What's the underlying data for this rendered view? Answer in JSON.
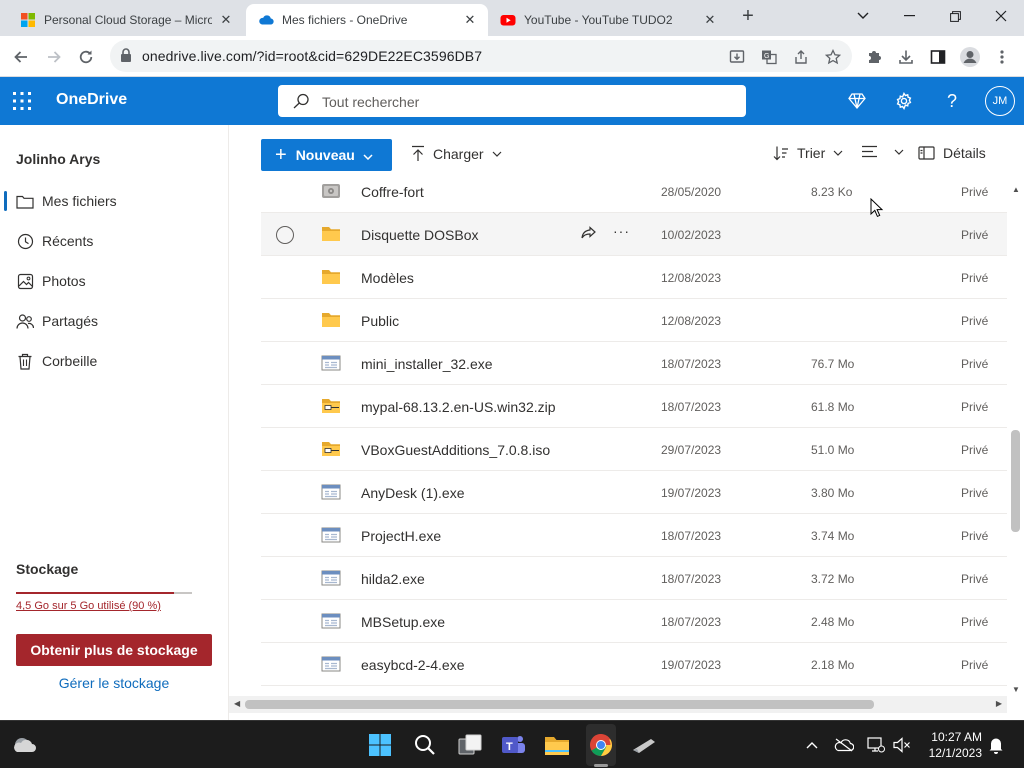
{
  "browser": {
    "tabs": [
      {
        "title": "Personal Cloud Storage – Micros",
        "active": false,
        "favicon": "microsoft-logo-icon"
      },
      {
        "title": "Mes fichiers - OneDrive",
        "active": true,
        "favicon": "onedrive-cloud-icon"
      },
      {
        "title": "YouTube - YouTube TUDO2",
        "active": false,
        "favicon": "youtube-icon"
      }
    ],
    "new_tab": "+",
    "url": "onedrive.live.com/?id=root&cid=629DE22EC3596DB7"
  },
  "header": {
    "app_name": "OneDrive",
    "search_placeholder": "Tout rechercher",
    "avatar_initials": "JM",
    "accent": "#0f78d4"
  },
  "sidebar": {
    "user_name": "Jolinho Arys",
    "items": [
      {
        "label": "Mes fichiers",
        "icon": "folder-icon",
        "selected": true
      },
      {
        "label": "Récents",
        "icon": "clock-icon",
        "selected": false
      },
      {
        "label": "Photos",
        "icon": "photo-icon",
        "selected": false
      },
      {
        "label": "Partagés",
        "icon": "people-icon",
        "selected": false
      },
      {
        "label": "Corbeille",
        "icon": "trash-icon",
        "selected": false
      }
    ],
    "storage": {
      "title": "Stockage",
      "usage_text": "4,5 Go sur 5 Go utilisé (90 %)",
      "usage_fraction": 0.9,
      "get_more_label": "Obtenir plus de stockage",
      "manage_label": "Gérer le stockage",
      "warning_color": "#a4262c"
    }
  },
  "commandbar": {
    "new_label": "Nouveau",
    "upload_label": "Charger",
    "sort_label": "Trier",
    "details_label": "Détails"
  },
  "files": [
    {
      "name": "Coffre-fort",
      "icon": "vault-icon",
      "modified": "28/05/2020",
      "size": "8.23 Ko",
      "access": "Privé"
    },
    {
      "name": "Disquette DOSBox",
      "icon": "folder-icon",
      "modified": "10/02/2023",
      "size": "",
      "access": "Privé"
    },
    {
      "name": "Modèles",
      "icon": "folder-icon",
      "modified": "12/08/2023",
      "size": "",
      "access": "Privé"
    },
    {
      "name": "Public",
      "icon": "folder-icon",
      "modified": "12/08/2023",
      "size": "",
      "access": "Privé"
    },
    {
      "name": "mini_installer_32.exe",
      "icon": "executable-icon",
      "modified": "18/07/2023",
      "size": "76.7 Mo",
      "access": "Privé"
    },
    {
      "name": "mypal-68.13.2.en-US.win32.zip",
      "icon": "archive-icon",
      "modified": "18/07/2023",
      "size": "61.8 Mo",
      "access": "Privé"
    },
    {
      "name": "VBoxGuestAdditions_7.0.8.iso",
      "icon": "archive-icon",
      "modified": "29/07/2023",
      "size": "51.0 Mo",
      "access": "Privé"
    },
    {
      "name": "AnyDesk (1).exe",
      "icon": "executable-icon",
      "modified": "19/07/2023",
      "size": "3.80 Mo",
      "access": "Privé"
    },
    {
      "name": "ProjectH.exe",
      "icon": "executable-icon",
      "modified": "18/07/2023",
      "size": "3.74 Mo",
      "access": "Privé"
    },
    {
      "name": "hilda2.exe",
      "icon": "executable-icon",
      "modified": "18/07/2023",
      "size": "3.72 Mo",
      "access": "Privé"
    },
    {
      "name": "MBSetup.exe",
      "icon": "executable-icon",
      "modified": "18/07/2023",
      "size": "2.48 Mo",
      "access": "Privé"
    },
    {
      "name": "easybcd-2-4.exe",
      "icon": "executable-icon",
      "modified": "19/07/2023",
      "size": "2.18 Mo",
      "access": "Privé"
    }
  ],
  "taskbar": {
    "time": "10:27 AM",
    "date": "12/1/2023"
  }
}
